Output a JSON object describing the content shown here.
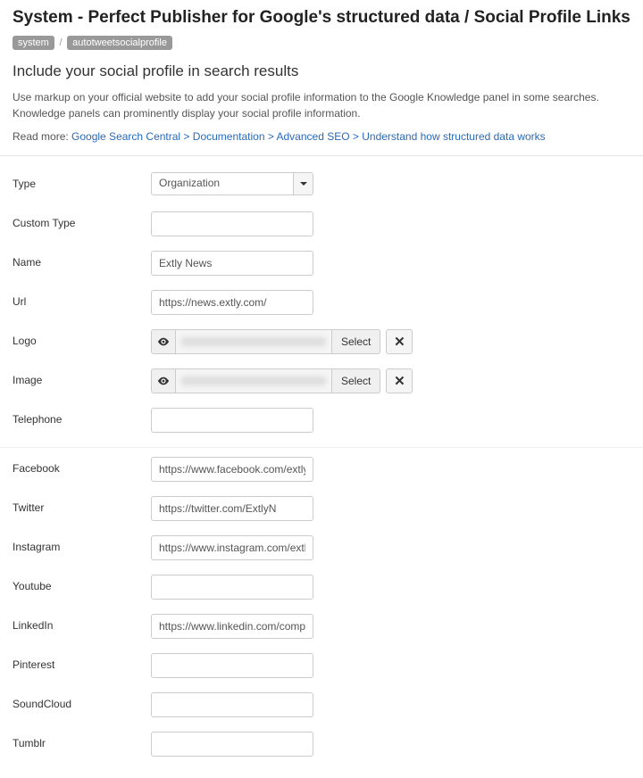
{
  "header": {
    "title": "System - Perfect Publisher for Google's structured data / Social Profile Links",
    "crumbs": [
      "system",
      "autotweetsocialprofile"
    ],
    "crumb_sep": "/"
  },
  "intro": {
    "subtitle": "Include your social profile in search results",
    "desc": "Use markup on your official website to add your social profile information to the Google Knowledge panel in some searches. Knowledge panels can prominently display your social profile information.",
    "readmore_prefix": "Read more: ",
    "readmore_link": "Google Search Central > Documentation > Advanced SEO > Understand how structured data works"
  },
  "form": {
    "type": {
      "label": "Type",
      "value": "Organization"
    },
    "custom_type": {
      "label": "Custom Type",
      "value": ""
    },
    "name": {
      "label": "Name",
      "value": "Extly News"
    },
    "url": {
      "label": "Url",
      "value": "https://news.extly.com/"
    },
    "logo": {
      "label": "Logo",
      "select_label": "Select"
    },
    "image": {
      "label": "Image",
      "select_label": "Select"
    },
    "telephone": {
      "label": "Telephone",
      "value": ""
    },
    "facebook": {
      "label": "Facebook",
      "value": "https://www.facebook.com/extlynews"
    },
    "twitter": {
      "label": "Twitter",
      "value": "https://twitter.com/ExtlyN"
    },
    "instagram": {
      "label": "Instagram",
      "value": "https://www.instagram.com/extlynews"
    },
    "youtube": {
      "label": "Youtube",
      "value": ""
    },
    "linkedin": {
      "label": "LinkedIn",
      "value": "https://www.linkedin.com/company/extly"
    },
    "pinterest": {
      "label": "Pinterest",
      "value": ""
    },
    "soundcloud": {
      "label": "SoundCloud",
      "value": ""
    },
    "tumblr": {
      "label": "Tumblr",
      "value": ""
    }
  }
}
